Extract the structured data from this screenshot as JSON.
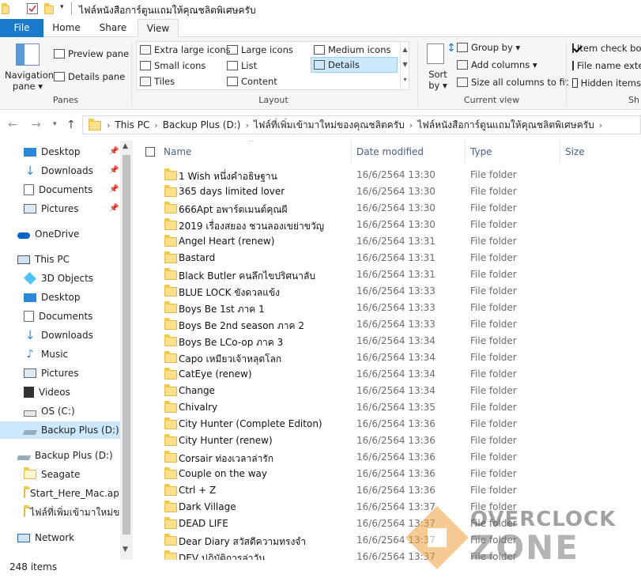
{
  "window": {
    "title": "ไฟล์หนังสือการ์ตูนแถมให้คุณชลิตพิเศษครับ"
  },
  "ribbon_tabs": [
    {
      "label": "File"
    },
    {
      "label": "Home"
    },
    {
      "label": "Share"
    },
    {
      "label": "View"
    }
  ],
  "ribbon": {
    "panes": {
      "nav_pane_line1": "Navigation",
      "nav_pane_line2": "pane ▾",
      "preview_pane": "Preview pane",
      "details_pane": "Details pane",
      "group_label": "Panes"
    },
    "layout": {
      "items": [
        "Extra large icons",
        "Large icons",
        "Medium icons",
        "Small icons",
        "List",
        "Details",
        "Tiles",
        "Content"
      ],
      "group_label": "Layout"
    },
    "current_view": {
      "sort_by_line1": "Sort",
      "sort_by_line2": "by ▾",
      "group_by": "Group by ▾",
      "add_columns": "Add columns ▾",
      "size_all_columns": "Size all columns to fit",
      "group_label": "Current view"
    },
    "show_hide": {
      "item_check_boxes": "Item check boxes",
      "item_check_boxes_checked": true,
      "file_name_extensions": "File name extensions",
      "hidden_items": "Hidden items",
      "group_label": "Sh"
    }
  },
  "address": {
    "crumbs": [
      "This PC",
      "Backup Plus (D:)",
      "ไฟล์ที่เพิ่มเข้ามาใหม่ของคุณชลิตครับ",
      "ไฟล์หนังสือการ์ตูนแถมให้คุณชลิตพิเศษครับ"
    ]
  },
  "nav": {
    "quick_access": [
      {
        "label": "Desktop",
        "icon": "desktop-icon"
      },
      {
        "label": "Downloads",
        "icon": "download-arrow-icon"
      },
      {
        "label": "Documents",
        "icon": "documents-icon"
      },
      {
        "label": "Pictures",
        "icon": "pictures-icon"
      }
    ],
    "onedrive": "OneDrive",
    "this_pc": "This PC",
    "this_pc_items": [
      {
        "label": "3D Objects",
        "icon": "3d-objects-icon"
      },
      {
        "label": "Desktop",
        "icon": "desktop-icon"
      },
      {
        "label": "Documents",
        "icon": "documents-icon"
      },
      {
        "label": "Downloads",
        "icon": "download-arrow-icon"
      },
      {
        "label": "Music",
        "icon": "music-note-icon"
      },
      {
        "label": "Pictures",
        "icon": "pictures-icon"
      },
      {
        "label": "Videos",
        "icon": "film-strip-icon"
      },
      {
        "label": "OS (C:)",
        "icon": "drive-icon"
      },
      {
        "label": "Backup Plus (D:)",
        "icon": "external-drive-icon"
      }
    ],
    "backup_drive": "Backup Plus (D:)",
    "backup_items": [
      {
        "label": "Seagate"
      },
      {
        "label": "Start_Here_Mac.app"
      },
      {
        "label": "ไฟล์ที่เพิ่มเข้ามาใหม่ของ"
      }
    ],
    "network": "Network"
  },
  "columns": {
    "name": "Name",
    "date_modified": "Date modified",
    "type": "Type",
    "size": "Size"
  },
  "files": [
    {
      "name": "1 Wish หนึ่งคำอธิษฐาน",
      "date": "16/6/2564 13:30",
      "type": "File folder"
    },
    {
      "name": "365 days limited lover",
      "date": "16/6/2564 13:30",
      "type": "File folder"
    },
    {
      "name": "666Apt อพาร์ตเมนต์คุณผี",
      "date": "16/6/2564 13:30",
      "type": "File folder"
    },
    {
      "name": "2019 เรื่องสยอง ชวนลองเขย่าขวัญ",
      "date": "16/6/2564 13:30",
      "type": "File folder"
    },
    {
      "name": "Angel Heart (renew)",
      "date": "16/6/2564 13:31",
      "type": "File folder"
    },
    {
      "name": "Bastard",
      "date": "16/6/2564 13:31",
      "type": "File folder"
    },
    {
      "name": "Black Butler คนลึกไขปริศนาลับ",
      "date": "16/6/2564 13:31",
      "type": "File folder"
    },
    {
      "name": "BLUE LOCK ขังดวลแข้ง",
      "date": "16/6/2564 13:33",
      "type": "File folder"
    },
    {
      "name": "Boys Be 1st ภาค 1",
      "date": "16/6/2564 13:33",
      "type": "File folder"
    },
    {
      "name": "Boys Be 2nd season ภาค 2",
      "date": "16/6/2564 13:33",
      "type": "File folder"
    },
    {
      "name": "Boys Be LCo-op ภาค 3",
      "date": "16/6/2564 13:34",
      "type": "File folder"
    },
    {
      "name": "Capo เหมียวเจ้าหลุดโลก",
      "date": "16/6/2564 13:34",
      "type": "File folder"
    },
    {
      "name": "CatEye (renew)",
      "date": "16/6/2564 13:34",
      "type": "File folder"
    },
    {
      "name": "Change",
      "date": "16/6/2564 13:34",
      "type": "File folder"
    },
    {
      "name": "Chivalry",
      "date": "16/6/2564 13:35",
      "type": "File folder"
    },
    {
      "name": "City Hunter (Complete Editon)",
      "date": "16/6/2564 13:36",
      "type": "File folder"
    },
    {
      "name": "City Hunter (renew)",
      "date": "16/6/2564 13:36",
      "type": "File folder"
    },
    {
      "name": "Corsair ท่องเวลาล่ารัก",
      "date": "16/6/2564 13:36",
      "type": "File folder"
    },
    {
      "name": "Couple on the way",
      "date": "16/6/2564 13:36",
      "type": "File folder"
    },
    {
      "name": "Ctrl + Z",
      "date": "16/6/2564 13:36",
      "type": "File folder"
    },
    {
      "name": "Dark Village",
      "date": "16/6/2564 13:37",
      "type": "File folder"
    },
    {
      "name": "DEAD LIFE",
      "date": "16/6/2564 13:37",
      "type": "File folder"
    },
    {
      "name": "Dear Diary สวัสดีความทรงจำ",
      "date": "16/6/2564 13:37",
      "type": "File folder"
    },
    {
      "name": "DEV ปฏิบัติการล่าวัน",
      "date": "16/6/2564 13:37",
      "type": "File folder"
    }
  ],
  "status": {
    "item_count": "248 items"
  },
  "watermark": {
    "line1": "OVERCLOCK",
    "line2": "ZONE"
  },
  "colors": {
    "file_tab": "#1979ca",
    "selected_nav": "#cce8ff",
    "folder": "#ffe08a",
    "header_text": "#4d6082"
  }
}
